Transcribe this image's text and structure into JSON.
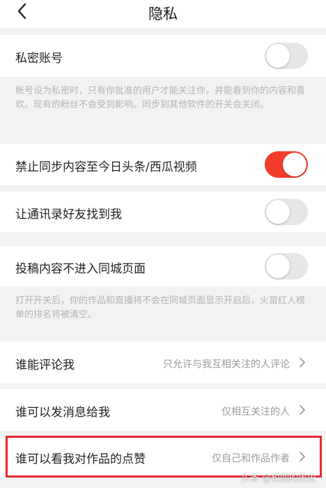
{
  "header": {
    "title": "隐私"
  },
  "settings": {
    "private_account": {
      "label": "私密账号",
      "enabled": false,
      "description": "账号设为私密时，只有你批准的用户才能关注你，并能看到你的内容和喜欢。现有的粉丝不会受到影响。同步到其他软件的开关会关闭。"
    },
    "no_sync": {
      "label": "禁止同步内容至今日头条/西瓜视频",
      "enabled": true
    },
    "contacts_find": {
      "label": "让通讯录好友找到我",
      "enabled": false
    },
    "not_local_page": {
      "label": "投稿内容不进入同城页面",
      "enabled": false,
      "description": "打开开关后，你的作品和直播将不会在同城页面显示开启后，火苗红人榜单的排名将被清空。"
    },
    "who_comment": {
      "label": "谁能评论我",
      "value": "只允许与我互相关注的人评论"
    },
    "who_message": {
      "label": "谁可以发消息给我",
      "value": "仅相互关注的人"
    },
    "who_likes": {
      "label": "谁可以看我对作品的点赞",
      "value": "仅自己和作品作者"
    }
  },
  "watermark": "头条 @轮回的历史",
  "colors": {
    "toggle_on": "#f23d2c",
    "toggle_off": "#e6e6e6",
    "highlight_border": "#e8282c"
  }
}
